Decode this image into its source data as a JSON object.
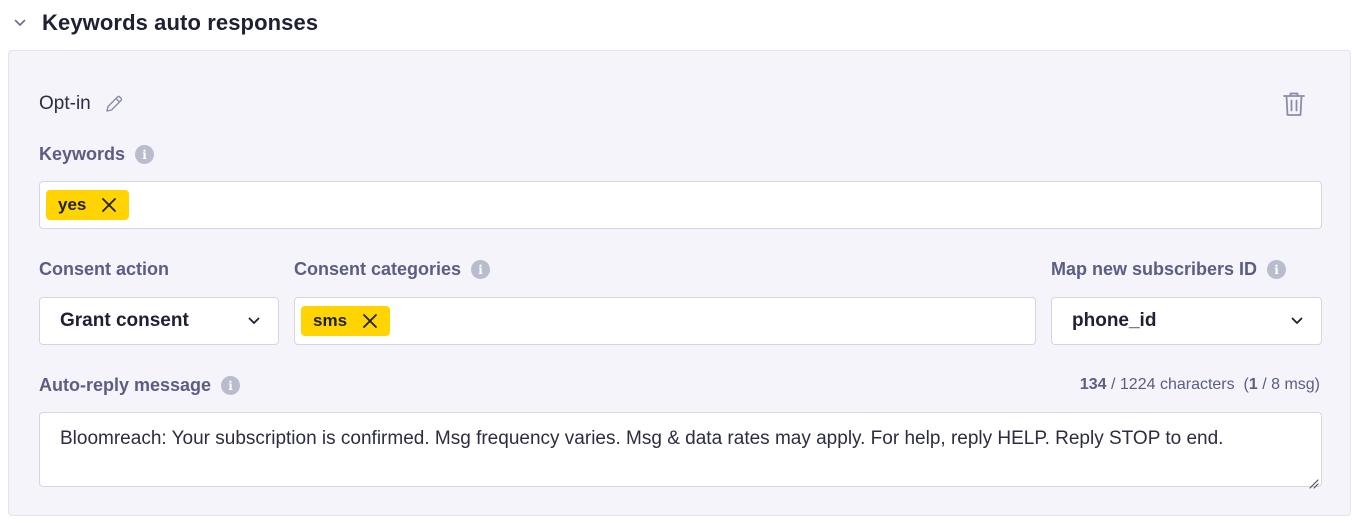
{
  "section": {
    "title": "Keywords auto responses"
  },
  "rule": {
    "name": "Opt-in"
  },
  "keywords": {
    "label": "Keywords",
    "tags": [
      "yes"
    ]
  },
  "consent_action": {
    "label": "Consent action",
    "value": "Grant consent"
  },
  "consent_categories": {
    "label": "Consent categories",
    "tags": [
      "sms"
    ]
  },
  "map_subscribers": {
    "label": "Map new subscribers ID",
    "value": "phone_id"
  },
  "auto_reply": {
    "label": "Auto-reply message",
    "count": "134",
    "limit_text": " / 1224 characters  (",
    "msg_count": "1",
    "msg_limit_text": " / 8 msg)",
    "message": "Bloomreach: Your subscription is confirmed. Msg frequency varies. Msg & data rates may apply. For help, reply HELP. Reply STOP to end."
  },
  "icons": {
    "collapse": "chevron-down-icon",
    "edit": "pencil-icon",
    "delete": "trash-icon",
    "info": "info-icon",
    "remove_tag": "close-icon"
  },
  "colors": {
    "chip": "#ffd400",
    "label": "#5b5d85",
    "panel": "#f4f4fa"
  }
}
